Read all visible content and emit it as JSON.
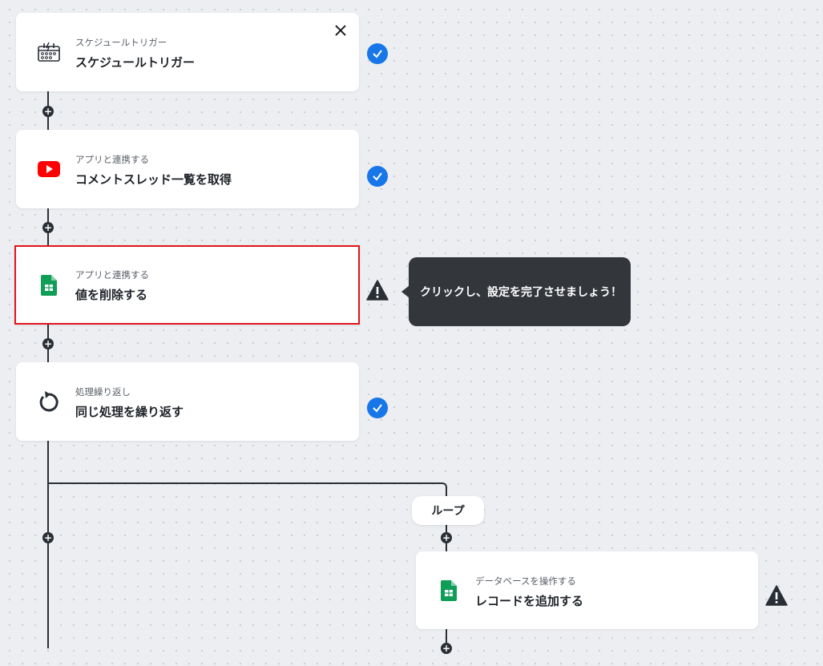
{
  "steps": [
    {
      "subtitle": "スケジュールトリガー",
      "title": "スケジュールトリガー",
      "icon": "schedule-icon",
      "status": "complete"
    },
    {
      "subtitle": "アプリと連携する",
      "title": "コメントスレッド一覧を取得",
      "icon": "youtube-icon",
      "status": "complete"
    },
    {
      "subtitle": "アプリと連携する",
      "title": "値を削除する",
      "icon": "google-sheets-icon",
      "status": "warning"
    },
    {
      "subtitle": "処理繰り返し",
      "title": "同じ処理を繰り返す",
      "icon": "loop-icon",
      "status": "complete"
    }
  ],
  "loop": {
    "label": "ループ",
    "step": {
      "subtitle": "データベースを操作する",
      "title": "レコードを追加する",
      "icon": "google-sheets-icon",
      "status": "warning"
    }
  },
  "tooltip": {
    "text": "クリックし、設定を完了させましょう！"
  },
  "colors": {
    "accent": "#1877e8",
    "selected_border": "#e0161b",
    "connector": "#2a2f36",
    "tooltip_bg": "#33363b",
    "sheets_green": "#0f9d58",
    "youtube_red": "#ff0000"
  }
}
